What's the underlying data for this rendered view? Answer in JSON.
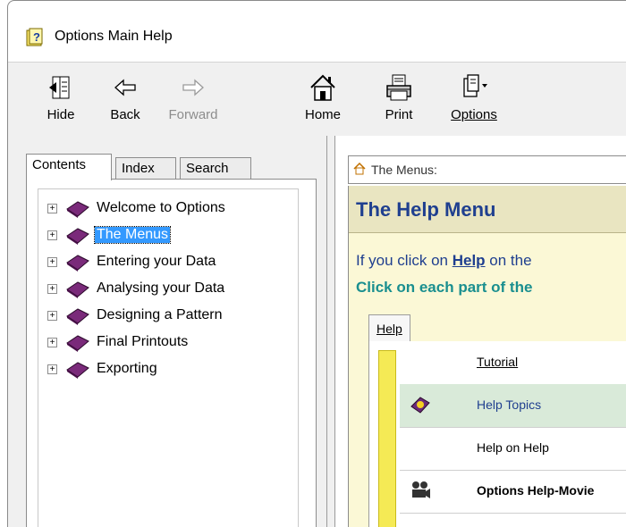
{
  "window": {
    "title": "Options Main Help"
  },
  "toolbar": {
    "hide": "Hide",
    "back": "Back",
    "forward": "Forward",
    "home": "Home",
    "print": "Print",
    "options": "Options"
  },
  "nav_tabs": {
    "contents": "Contents",
    "index": "Index",
    "search": "Search"
  },
  "tree": {
    "items": [
      {
        "label": "Welcome to Options"
      },
      {
        "label": "The Menus"
      },
      {
        "label": "Entering your Data"
      },
      {
        "label": "Analysing your Data"
      },
      {
        "label": "Designing a Pattern"
      },
      {
        "label": "Final Printouts"
      },
      {
        "label": "Exporting"
      }
    ],
    "selected": "The Menus"
  },
  "content": {
    "breadcrumb": "The Menus:",
    "heading": "The Help Menu",
    "intro_prefix": "If you click on ",
    "intro_link": "Help",
    "intro_suffix": " on the",
    "click_text": "Click on each part of the",
    "menu_tab": "Help",
    "menu_items": [
      {
        "label": "Tutorial"
      },
      {
        "label": "Help Topics"
      },
      {
        "label": "Help on Help"
      },
      {
        "label": "Options Help-Movie"
      }
    ]
  },
  "colors": {
    "heading": "#1f3f8f",
    "click_text": "#1a8f8f",
    "content_bg": "#fbf8d6",
    "selection": "#3399ff",
    "gutter": "#f5ea55"
  }
}
